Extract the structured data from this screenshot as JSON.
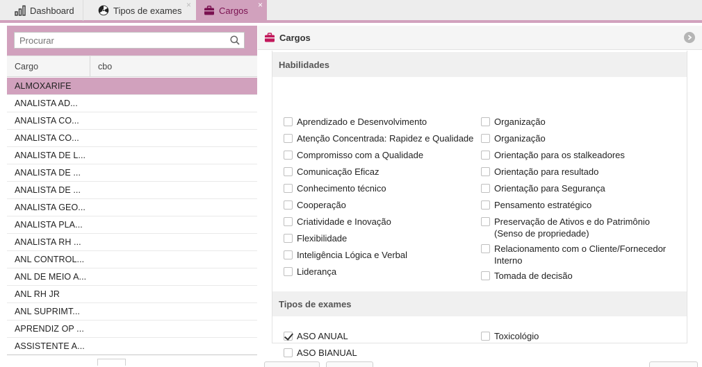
{
  "tabs": [
    {
      "label": "Dashboard",
      "icon": "bar-chart-icon"
    },
    {
      "label": "Tipos de exames",
      "icon": "radiation-icon",
      "close": "×"
    },
    {
      "label": "Cargos",
      "icon": "briefcase-icon",
      "close": "×",
      "active": true
    }
  ],
  "search": {
    "placeholder": "Procurar",
    "value": ""
  },
  "grid": {
    "headers": [
      "Cargo",
      "cbo"
    ],
    "rows": [
      "ALMOXARIFE",
      "ANALISTA AD...",
      "ANALISTA CO...",
      "ANALISTA CO...",
      "ANALISTA DE L...",
      "ANALISTA DE ...",
      "ANALISTA DE ...",
      "ANALISTA GEO...",
      "ANALISTA PLA...",
      "ANALISTA RH ...",
      "ANL CONTROL...",
      "ANL DE MEIO A...",
      "ANL RH JR",
      "ANL SUPRIMT...",
      "APRENDIZ OP ...",
      "ASSISTENTE A..."
    ],
    "selected_index": 0
  },
  "panel": {
    "title": "Cargos"
  },
  "habilidades": {
    "title": "Habilidades",
    "col1": [
      "Aprendizado e Desenvolvimento",
      "Atenção Concentrada: Rapidez e Qualidade",
      "Compromisso com a Qualidade",
      "Comunicação Eficaz",
      "Conhecimento técnico",
      "Cooperação",
      "Criatividade e Inovação",
      "Flexibilidade",
      "Inteligência Lógica e Verbal",
      "Liderança"
    ],
    "col2": [
      "Organização",
      "Organização",
      "Orientação para os stalkeadores",
      "Orientação para resultado",
      "Orientação para Segurança",
      "Pensamento estratégico",
      "Preservação de Ativos e do Patrimônio (Senso de propriedade)",
      "Relacionamento com o Cliente/Fornecedor Interno",
      "Tomada de decisão"
    ]
  },
  "tipos_exames": {
    "title": "Tipos de exames",
    "items": [
      {
        "label": "ASO ANUAL",
        "checked": true
      },
      {
        "label": "Toxicológio",
        "checked": false
      },
      {
        "label": "ASO BIANUAL",
        "checked": false
      }
    ]
  },
  "colors": {
    "accent": "#d1a1bd",
    "accent_text": "#7a1150",
    "icon_red": "#c2185b"
  }
}
